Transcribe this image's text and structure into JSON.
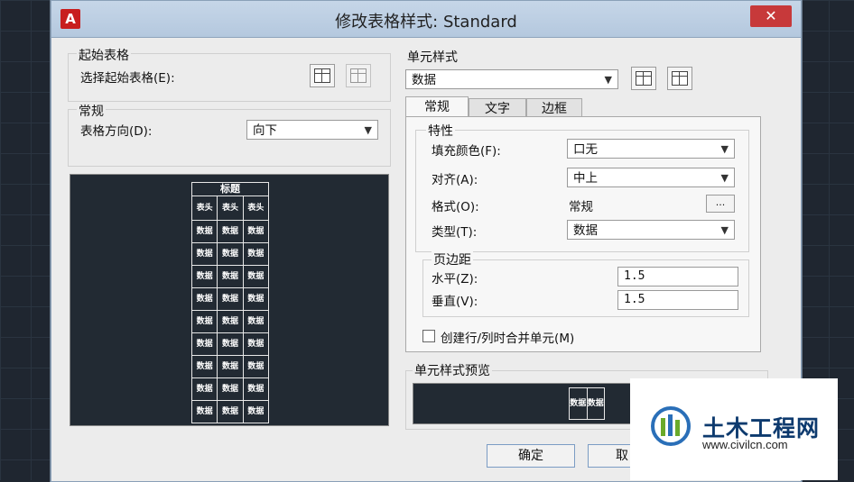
{
  "window": {
    "title": "修改表格样式: Standard",
    "close_label": "✕",
    "app_icon_label": "A"
  },
  "start_table": {
    "group_title": "起始表格",
    "select_label": "选择起始表格(E):"
  },
  "general": {
    "group_title": "常规",
    "direction_label": "表格方向(D):",
    "direction_value": "向下"
  },
  "preview_table": {
    "title": "标题",
    "header_row": [
      "表头",
      "表头",
      "表头"
    ],
    "data_cell": "数据",
    "data_rows": 9
  },
  "cell_style": {
    "group_title": "单元样式",
    "style_value": "数据",
    "tabs": [
      "常规",
      "文字",
      "边框"
    ],
    "active_tab": "常规",
    "properties": {
      "group_title": "特性",
      "fill_color_label": "填充颜色(F):",
      "fill_color_value": "口无",
      "align_label": "对齐(A):",
      "align_value": "中上",
      "format_label": "格式(O):",
      "format_value": "常规",
      "format_button": "...",
      "type_label": "类型(T):",
      "type_value": "数据"
    },
    "margins": {
      "group_title": "页边距",
      "horizontal_label": "水平(Z):",
      "horizontal_value": "1.5",
      "vertical_label": "垂直(V):",
      "vertical_value": "1.5"
    },
    "merge_checkbox_label": "创建行/列时合并单元(M)"
  },
  "cell_preview": {
    "group_title": "单元样式预览"
  },
  "buttons": {
    "ok": "确定",
    "cancel_partial": "取"
  },
  "watermark": {
    "name": "土木工程网",
    "url": "www.civilcn.com"
  },
  "colors": {
    "accent_red": "#c81e1e",
    "close_red": "#c7393a",
    "preview_bg": "#222a33",
    "watermark_blue": "#0d3a6e"
  }
}
